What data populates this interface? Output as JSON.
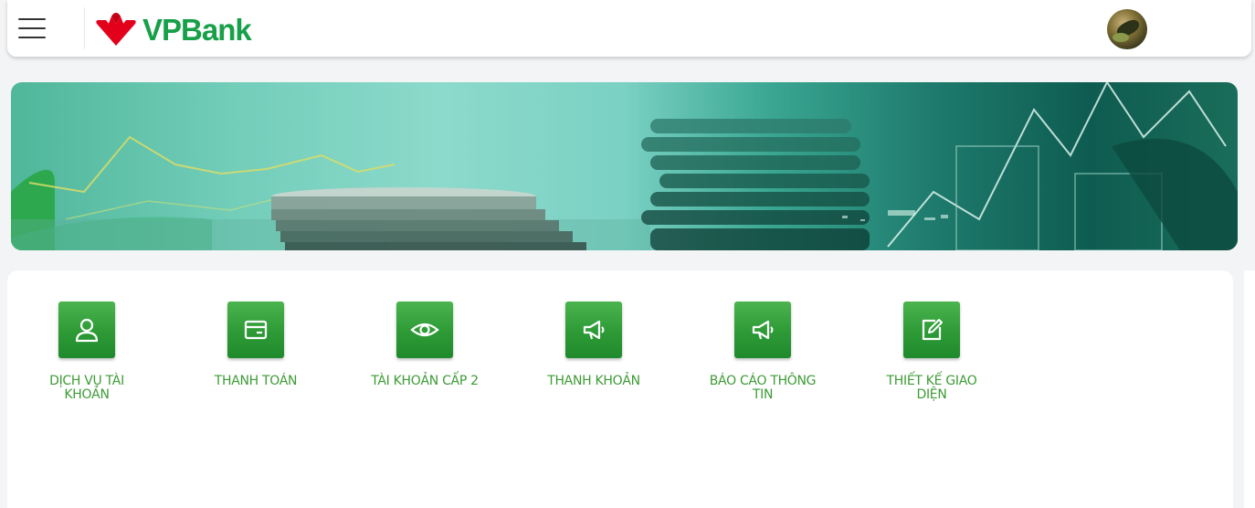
{
  "header": {
    "menu_icon": "hamburger-menu-icon",
    "logo_text": "VPBank",
    "logo_mark": "vpbank-logo-mark",
    "avatar_icon": "user-avatar",
    "brand_green": "#17a048",
    "brand_red": "#e3001b"
  },
  "banner": {
    "image": "finance-coins-chart-banner"
  },
  "menu": {
    "items": [
      {
        "label": "DỊCH VỤ TÀI KHOẢN",
        "icon": "user-icon"
      },
      {
        "label": "THANH TOÁN",
        "icon": "card-icon"
      },
      {
        "label": "TÀI KHOẢN CẤP 2",
        "icon": "eye-icon"
      },
      {
        "label": "THANH KHOẢN",
        "icon": "megaphone-icon"
      },
      {
        "label": "BÁO CÁO THÔNG TIN",
        "icon": "megaphone-icon"
      },
      {
        "label": "THIẾT KẾ GIAO DIỆN",
        "icon": "edit-icon"
      }
    ],
    "accent": "#3d9b35"
  }
}
